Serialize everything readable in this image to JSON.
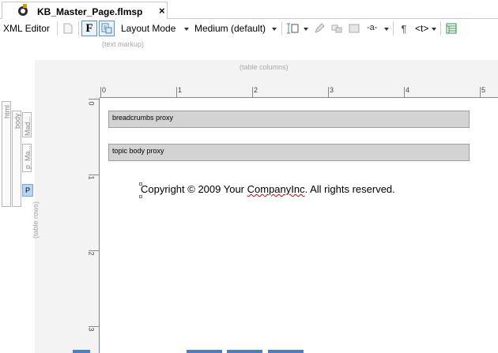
{
  "tab": {
    "title": "KB_Master_Page.flmsp",
    "close": "×"
  },
  "toolbar": {
    "xml_editor": "XML Editor",
    "text_format_button": "F",
    "layout_mode": "Layout Mode",
    "medium": "Medium (default)",
    "pilcrow": "¶",
    "tags": "<t>",
    "hyphen_glyph": "-a-"
  },
  "editor": {
    "text_markup_hint": "(text markup)",
    "table_columns_hint": "(table columns)",
    "table_rows_hint": "(table rows)"
  },
  "ruler": {
    "h": [
      "0",
      "1",
      "2",
      "3",
      "4",
      "5"
    ],
    "v": [
      "0",
      "1",
      "2",
      "3"
    ]
  },
  "page": {
    "breadcrumbs_proxy": "breadcrumbs proxy",
    "topic_body_proxy": "topic body proxy",
    "copyright_prefix": "Copyright © 2009 Your ",
    "copyright_squiggle": "CompanyInc",
    "copyright_suffix": ". All rights reserved."
  },
  "structure": {
    "html": "html",
    "body": "body",
    "mad": "Mad...",
    "ma": "Ma...",
    "p_small": "p",
    "p": "P"
  },
  "colors": {
    "accent": "#4a7fc8",
    "proxy_fill": "#d3d3d3",
    "selected_block": "#b7d4f4",
    "spelling": "#d00000"
  }
}
